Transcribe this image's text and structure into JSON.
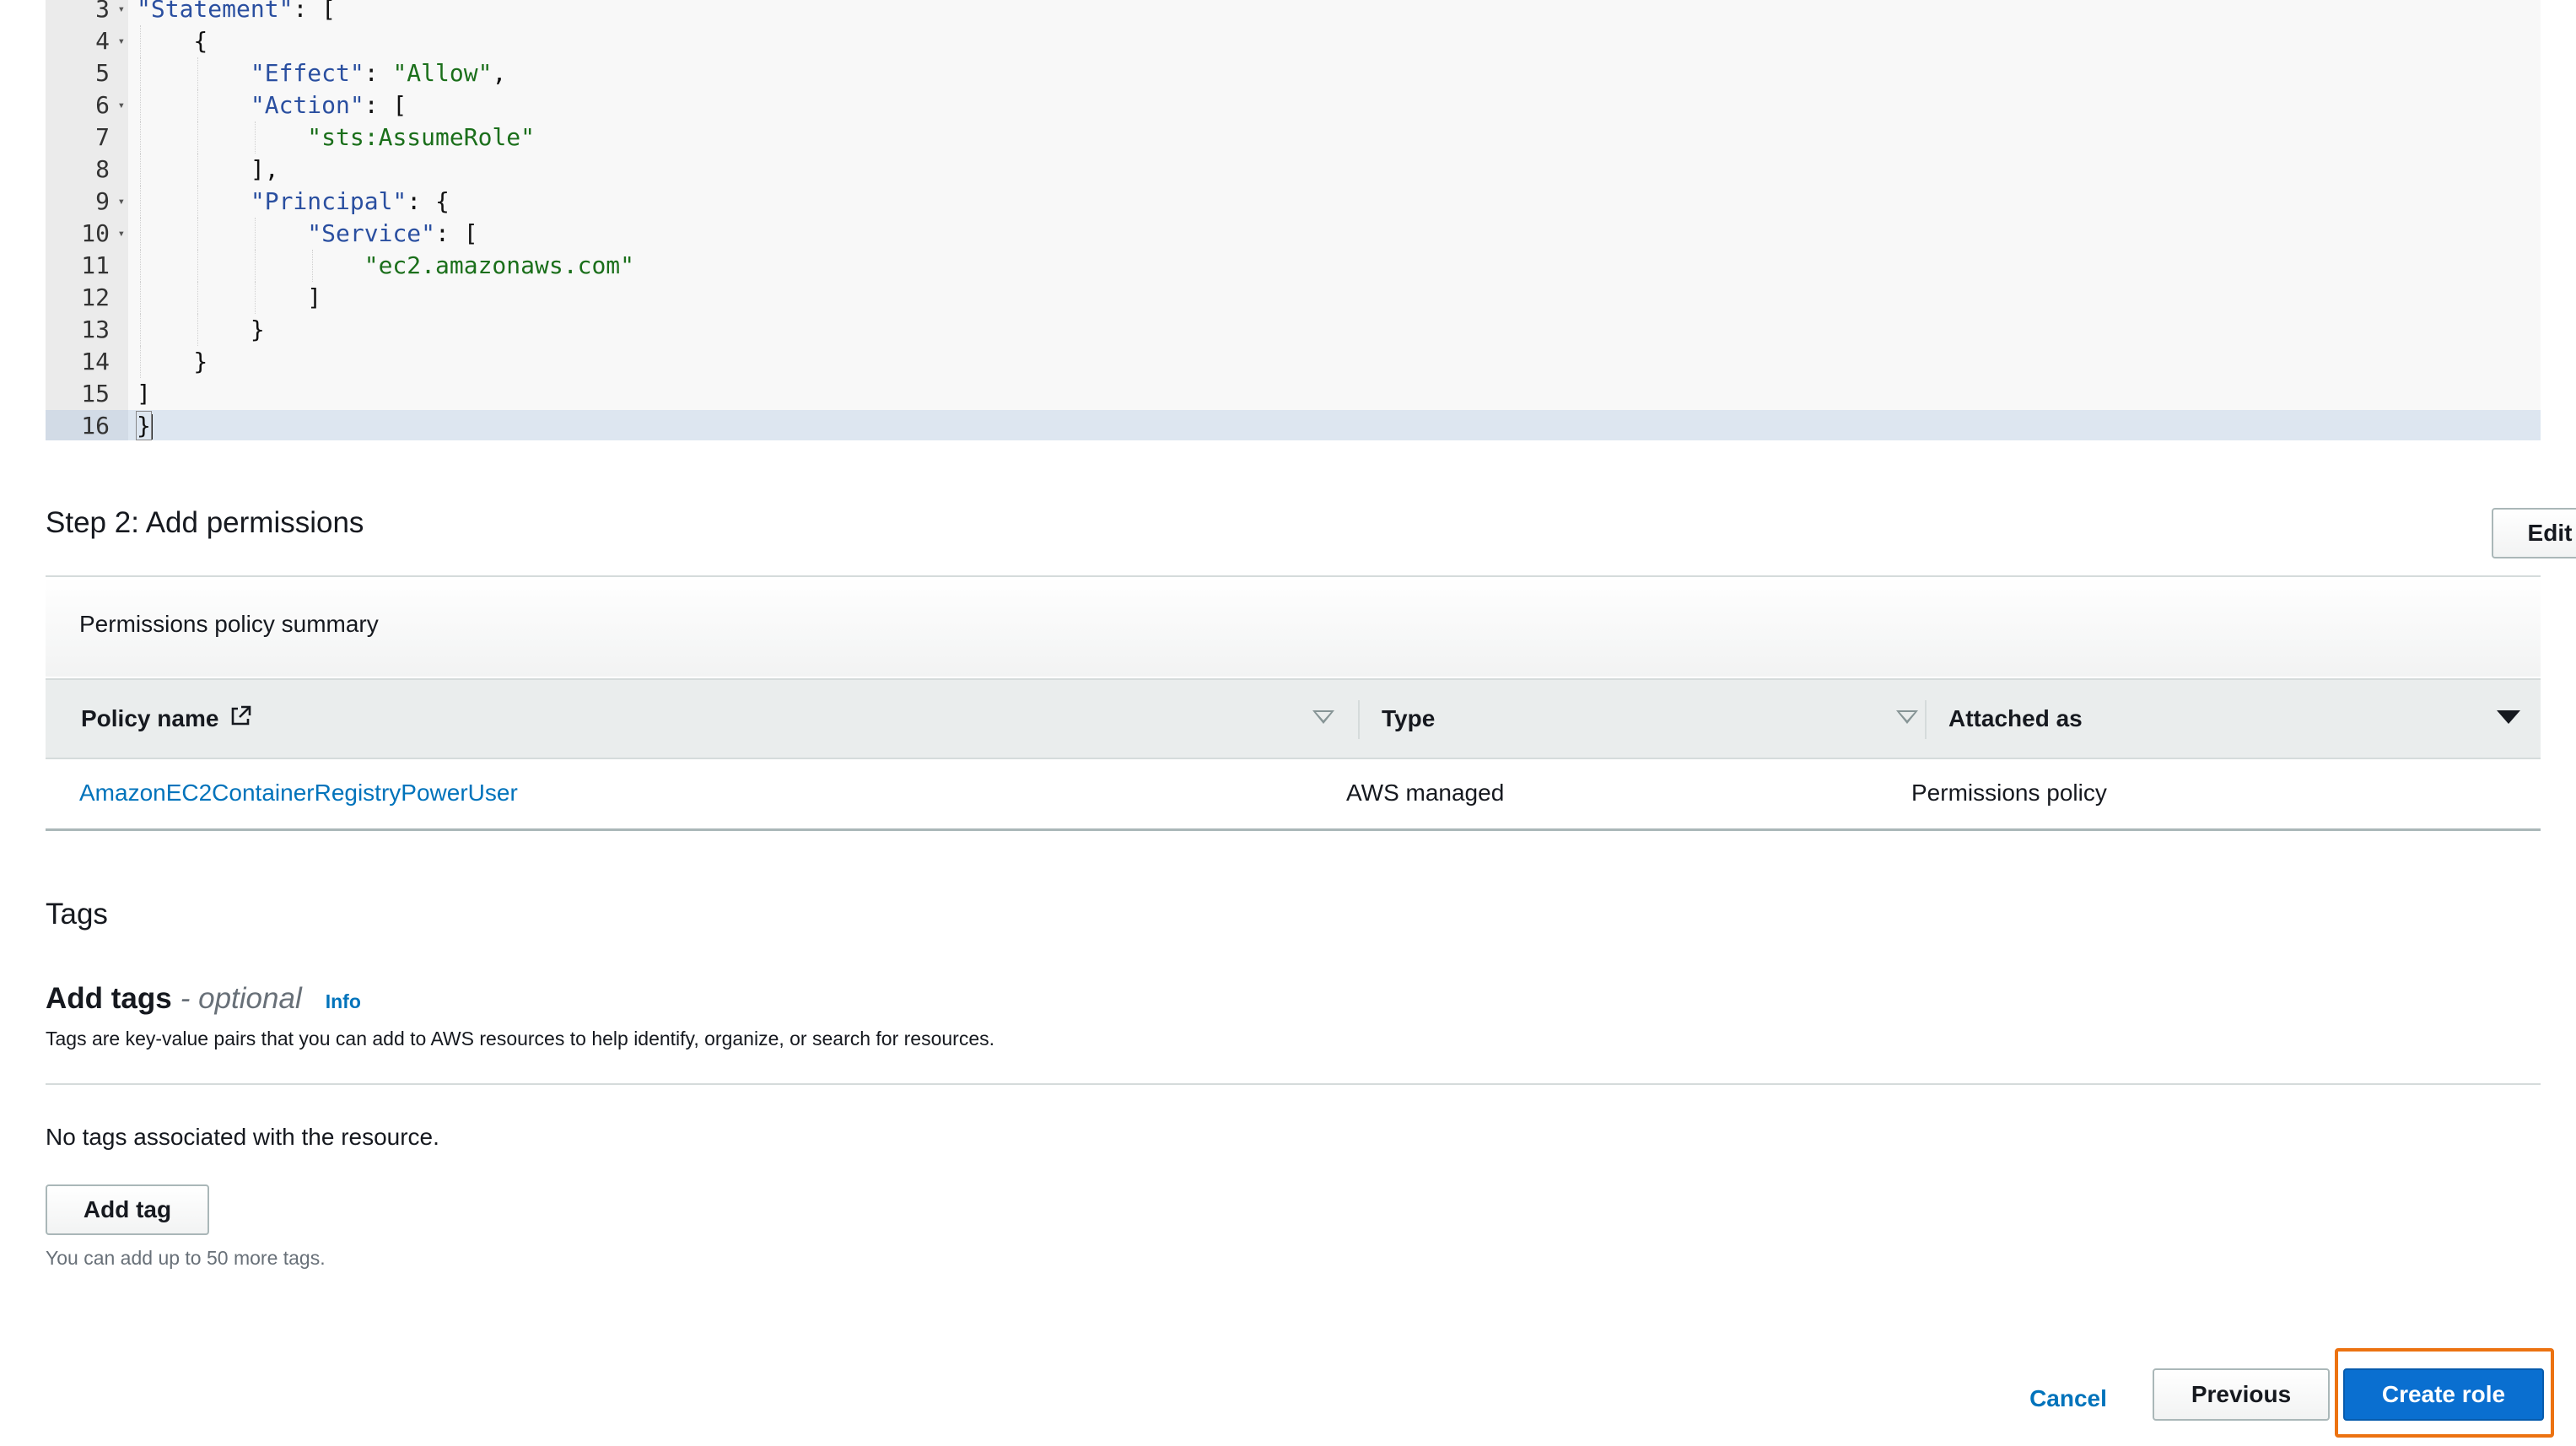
{
  "editor": {
    "lines": [
      {
        "num": "3",
        "fold": "▾",
        "html": "<span class=\"key\">\"Statement\"</span>: ["
      },
      {
        "num": "4",
        "fold": "▾",
        "html": "    {"
      },
      {
        "num": "5",
        "fold": "",
        "html": "        <span class=\"key\">\"Effect\"</span>: <span class=\"str\">\"Allow\"</span>,"
      },
      {
        "num": "6",
        "fold": "▾",
        "html": "        <span class=\"key\">\"Action\"</span>: ["
      },
      {
        "num": "7",
        "fold": "",
        "html": "            <span class=\"str\">\"sts:AssumeRole\"</span>"
      },
      {
        "num": "8",
        "fold": "",
        "html": "        ],"
      },
      {
        "num": "9",
        "fold": "▾",
        "html": "        <span class=\"key\">\"Principal\"</span>: {"
      },
      {
        "num": "10",
        "fold": "▾",
        "html": "            <span class=\"key\">\"Service\"</span>: ["
      },
      {
        "num": "11",
        "fold": "",
        "html": "                <span class=\"str\">\"ec2.amazonaws.com\"</span>"
      },
      {
        "num": "12",
        "fold": "",
        "html": "            ]"
      },
      {
        "num": "13",
        "fold": "",
        "html": "        }"
      },
      {
        "num": "14",
        "fold": "",
        "html": "    }"
      },
      {
        "num": "15",
        "fold": "",
        "html": "]"
      },
      {
        "num": "16",
        "fold": "",
        "html": "<span class=\"bracket-hl\">}</span><span class=\"cursor\"></span>"
      }
    ]
  },
  "step2": {
    "title": "Step 2: Add permissions",
    "edit_label": "Edit",
    "panel_label": "Permissions policy summary",
    "columns": [
      "Policy name",
      "Type",
      "Attached as"
    ],
    "row": {
      "policy_name": "AmazonEC2ContainerRegistryPowerUser",
      "type": "AWS managed",
      "attached_as": "Permissions policy"
    }
  },
  "tags": {
    "title": "Tags",
    "add_title": "Add tags",
    "optional": "- optional",
    "info": "Info",
    "description": "Tags are key-value pairs that you can add to AWS resources to help identify, organize, or search for resources.",
    "empty": "No tags associated with the resource.",
    "add_button": "Add tag",
    "hint": "You can add up to 50 more tags."
  },
  "footer": {
    "cancel": "Cancel",
    "previous": "Previous",
    "create": "Create role"
  },
  "colors": {
    "accent": "#0073bb",
    "primary_button": "#0a6fd0",
    "focus_ring": "#ec7211"
  }
}
